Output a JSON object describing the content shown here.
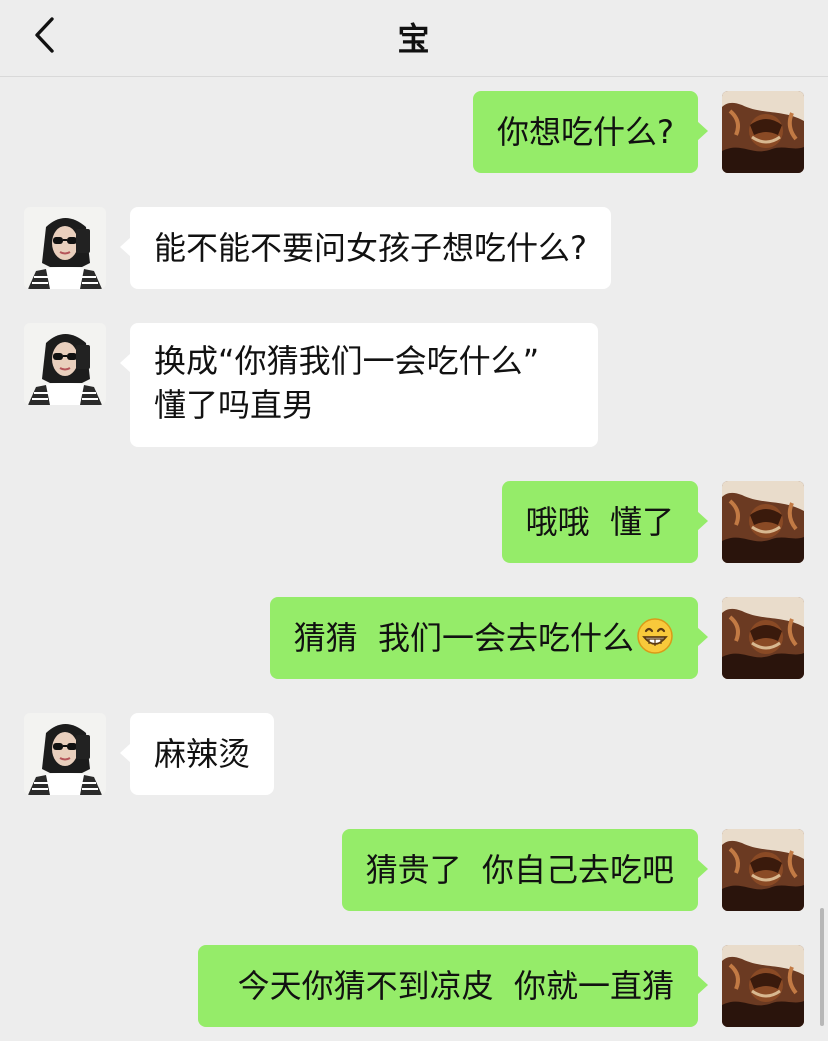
{
  "header": {
    "title": "宝",
    "back_icon": "chevron-left-icon"
  },
  "messages": [
    {
      "side": "right",
      "text": "你想吃什么?"
    },
    {
      "side": "left",
      "text": "能不能不要问女孩子想吃什么?"
    },
    {
      "side": "left",
      "lines": [
        "换成“你猜我们一会吃什么”",
        "懂了吗直男"
      ]
    },
    {
      "side": "right",
      "text": "哦哦  懂了"
    },
    {
      "side": "right",
      "text": "猜猜  我们一会去吃什么",
      "emoji": "grinning-face-icon"
    },
    {
      "side": "left",
      "text": "麻辣烫"
    },
    {
      "side": "right",
      "text": "猜贵了  你自己去吃吧"
    },
    {
      "side": "right",
      "text": "今天你猜不到凉皮  你就一直猜"
    }
  ],
  "colors": {
    "background": "#ededed",
    "sent_bubble": "#95ec69",
    "received_bubble": "#ffffff",
    "text": "#111111"
  }
}
